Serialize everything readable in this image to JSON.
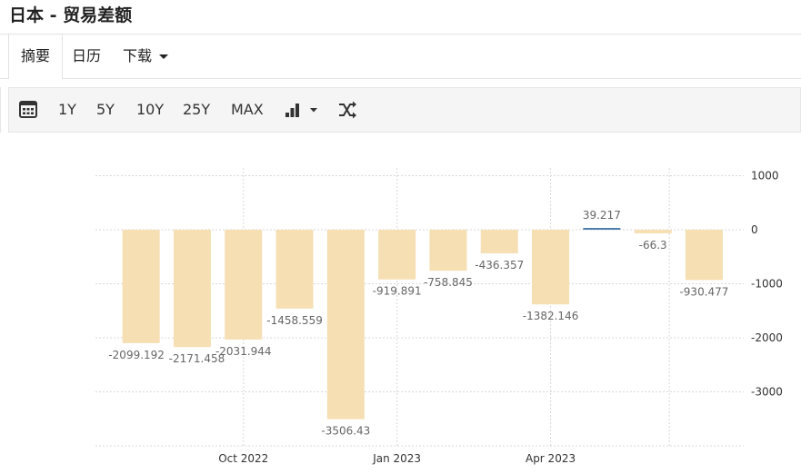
{
  "page": {
    "title": "日本 - 贸易差额"
  },
  "tabs": [
    {
      "label": "摘要",
      "active": true
    },
    {
      "label": "日历",
      "active": false
    },
    {
      "label": "下载",
      "active": false,
      "dropdown": true
    }
  ],
  "toolbar": {
    "calendar_icon": "calendar-icon",
    "ranges": [
      "1Y",
      "5Y",
      "10Y",
      "25Y",
      "MAX"
    ],
    "chart_type_icon": "bar-chart-icon",
    "shuffle_icon": "shuffle-icon"
  },
  "colors": {
    "bar": "#f5dfb3",
    "positive_line": "#4f7fb0",
    "grid": "#d8d8d8"
  },
  "chart_data": {
    "type": "bar",
    "categories": [
      "2022-08",
      "2022-09",
      "2022-10",
      "2022-11",
      "2022-12",
      "2023-01",
      "2023-02",
      "2023-03",
      "2023-04",
      "2023-05",
      "2023-06",
      "2023-07"
    ],
    "values": [
      -2099.192,
      -2171.458,
      -2031.944,
      -1458.559,
      -3506.43,
      -919.891,
      -758.845,
      -436.357,
      -1382.146,
      39.217,
      -66.3,
      -930.477
    ],
    "data_labels": [
      "-2099.192",
      "-2171.458",
      "-2031.944",
      "-1458.559",
      "-3506.43",
      "-919.891",
      "-758.845",
      "-436.357",
      "-1382.146",
      "39.217",
      "-66.3",
      "-930.477"
    ],
    "x_ticks": [
      {
        "label": "Oct 2022",
        "category": "2022-10"
      },
      {
        "label": "Jan 2023",
        "category": "2023-01"
      },
      {
        "label": "Apr 2023",
        "category": "2023-04"
      }
    ],
    "y_ticks": [
      1000,
      0,
      -1000,
      -2000,
      -3000
    ],
    "y_tick_labels": [
      "1000",
      "0",
      "-1000",
      "-2000",
      "-3000"
    ],
    "ylim": [
      -4000,
      1000
    ],
    "y_axis_side": "right",
    "grid": true,
    "title": "",
    "xlabel": "",
    "ylabel": ""
  }
}
